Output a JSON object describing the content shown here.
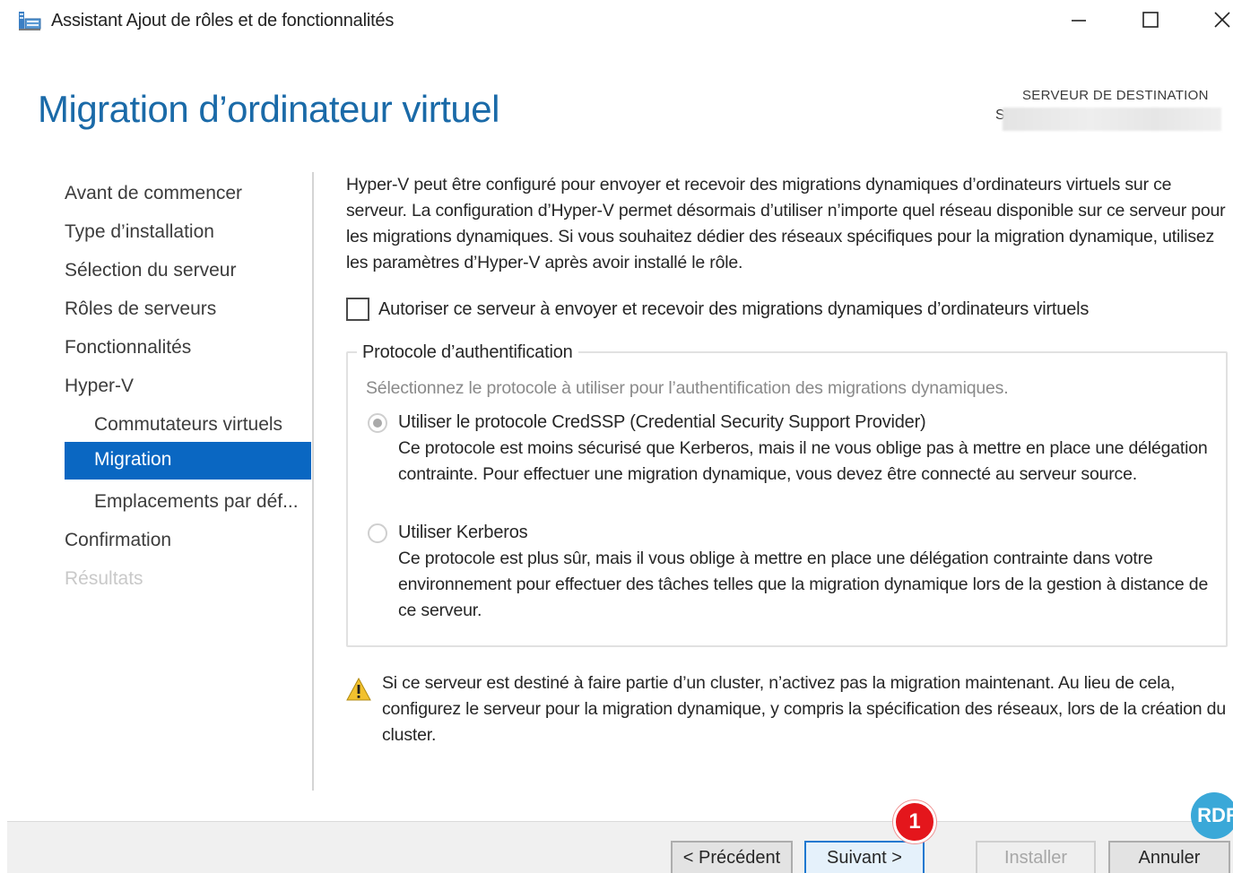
{
  "window": {
    "title": "Assistant Ajout de rôles et de fonctionnalités",
    "icon": "server-manager-icon",
    "controls": [
      "minimize-icon",
      "maximize-icon",
      "close-icon"
    ]
  },
  "header": {
    "page_title": "Migration d’ordinateur virtuel",
    "destination_label": "SERVEUR DE DESTINATION",
    "destination_value_visible": "S"
  },
  "nav": {
    "items": [
      {
        "label": "Avant de commencer",
        "state": "normal",
        "level": 0
      },
      {
        "label": "Type d’installation",
        "state": "normal",
        "level": 0
      },
      {
        "label": "Sélection du serveur",
        "state": "normal",
        "level": 0
      },
      {
        "label": "Rôles de serveurs",
        "state": "normal",
        "level": 0
      },
      {
        "label": "Fonctionnalités",
        "state": "normal",
        "level": 0
      },
      {
        "label": "Hyper-V",
        "state": "normal",
        "level": 0
      },
      {
        "label": "Commutateurs virtuels",
        "state": "normal",
        "level": 1
      },
      {
        "label": "Migration",
        "state": "active",
        "level": 1
      },
      {
        "label": "Emplacements par déf...",
        "state": "normal",
        "level": 1
      },
      {
        "label": "Confirmation",
        "state": "normal",
        "level": 0
      },
      {
        "label": "Résultats",
        "state": "disabled",
        "level": 0
      }
    ]
  },
  "main": {
    "intro": "Hyper-V peut être configuré pour envoyer et recevoir des migrations dynamiques d’ordinateurs virtuels sur ce serveur. La configuration d’Hyper-V permet désormais d’utiliser n’importe quel réseau disponible sur ce serveur pour les migrations dynamiques. Si vous souhaitez dédier des réseaux spécifiques pour la migration dynamique, utilisez les paramètres d’Hyper-V après avoir installé le rôle.",
    "allow_checkbox": {
      "label": "Autoriser ce serveur à envoyer et recevoir des migrations dynamiques d’ordinateurs virtuels",
      "checked": false
    },
    "auth_group": {
      "legend": "Protocole d’authentification",
      "hint": "Sélectionnez le protocole à utiliser pour l’authentification des migrations dynamiques.",
      "options": [
        {
          "title": "Utiliser le protocole CredSSP (Credential Security Support Provider)",
          "description": "Ce protocole est moins sécurisé que Kerberos, mais il ne vous oblige pas à mettre en place une délégation contrainte. Pour effectuer une migration dynamique, vous devez être connecté au serveur source.",
          "selected": true
        },
        {
          "title": "Utiliser Kerberos",
          "description": "Ce protocole est plus sûr, mais il vous oblige à mettre en place une délégation contrainte dans votre environnement pour effectuer des tâches telles que la migration dynamique lors de la gestion à distance de ce serveur.",
          "selected": false
        }
      ]
    },
    "warning": {
      "icon": "warning-icon",
      "text": "Si ce serveur est destiné à faire partie d’un cluster, n’activez pas la migration maintenant. Au lieu de cela, configurez le serveur pour la migration dynamique, y compris la spécification des réseaux, lors de la création du cluster."
    }
  },
  "footer": {
    "prev_label": "< Précédent",
    "next_label": "Suivant >",
    "install_label": "Installer",
    "cancel_label": "Annuler",
    "step_badge": "1",
    "logo_text": "RDR"
  },
  "colors": {
    "accent": "#0a67c2",
    "title_blue": "#1a6aa8",
    "badge_red": "#e4161c",
    "logo_blue": "#3aa8d8"
  }
}
